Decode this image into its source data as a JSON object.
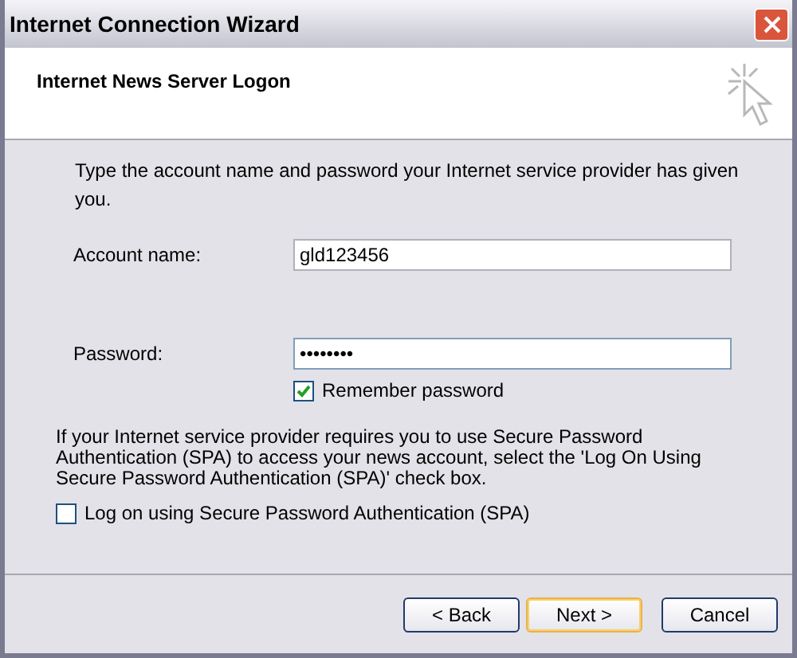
{
  "window": {
    "title": "Internet Connection Wizard"
  },
  "header": {
    "title": "Internet News Server Logon"
  },
  "intro": "Type the account name and password your Internet service provider has given you.",
  "fields": [
    {
      "label": "Account name:",
      "value": "gld123456",
      "focused": false
    },
    {
      "label": "Password:",
      "value": "••••••••",
      "focused": true
    }
  ],
  "remember": {
    "label": "Remember password",
    "checked": true
  },
  "spa_note": "If your Internet service provider requires you to use Secure Password Authentication (SPA) to access your news account, select the 'Log On Using Secure Password Authentication (SPA)' check box.",
  "spa": {
    "label": "Log on using Secure Password Authentication (SPA)",
    "checked": false
  },
  "buttons": [
    {
      "label": "< Back",
      "default": false
    },
    {
      "label": "Next >",
      "default": true
    },
    {
      "label": "Cancel",
      "default": false
    }
  ]
}
